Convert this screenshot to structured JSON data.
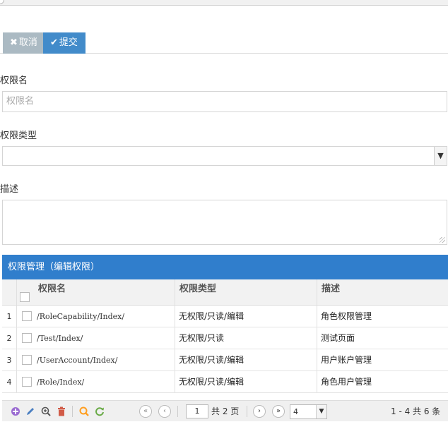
{
  "toolbar": {
    "cancel_icon": "✖",
    "cancel_label": "取消",
    "submit_icon": "✔",
    "submit_label": "提交"
  },
  "form": {
    "name_label": "权限名",
    "name_placeholder": "权限名",
    "type_label": "权限类型",
    "type_value": "",
    "desc_label": "描述",
    "desc_value": ""
  },
  "grid": {
    "title": "权限管理（编辑权限）",
    "columns": [
      "权限名",
      "权限类型",
      "描述"
    ],
    "rows": [
      {
        "num": "1",
        "name": "/RoleCapability/Index/",
        "type": "无权限/只读/编辑",
        "desc": "角色权限管理"
      },
      {
        "num": "2",
        "name": "/Test/Index/",
        "type": "无权限/只读",
        "desc": "测试页面"
      },
      {
        "num": "3",
        "name": "/UserAccount/Index/",
        "type": "无权限/只读/编辑",
        "desc": "用户账户管理"
      },
      {
        "num": "4",
        "name": "/Role/Index/",
        "type": "无权限/只读/编辑",
        "desc": "角色用户管理"
      }
    ]
  },
  "pager": {
    "icons": {
      "add": "plus-circle-icon",
      "edit": "pencil-icon",
      "view": "zoom-in-icon",
      "delete": "trash-icon",
      "search": "search-icon",
      "refresh": "refresh-icon"
    },
    "first_glyph": "«",
    "prev_glyph": "‹",
    "next_glyph": "›",
    "last_glyph": "»",
    "page_value": "1",
    "total_pages_text": "共 2 页",
    "page_size": "4",
    "records_text": "1 - 4  共 6 条"
  },
  "colors": {
    "accent_blue": "#428bca",
    "grid_title_blue": "#307ecc",
    "cancel_gray": "#abbac3",
    "icon_purple": "#9a6bd1",
    "icon_blue": "#4a7fc1",
    "icon_red": "#d15b47",
    "icon_orange": "#ff9e1f",
    "icon_green": "#69aa46"
  }
}
